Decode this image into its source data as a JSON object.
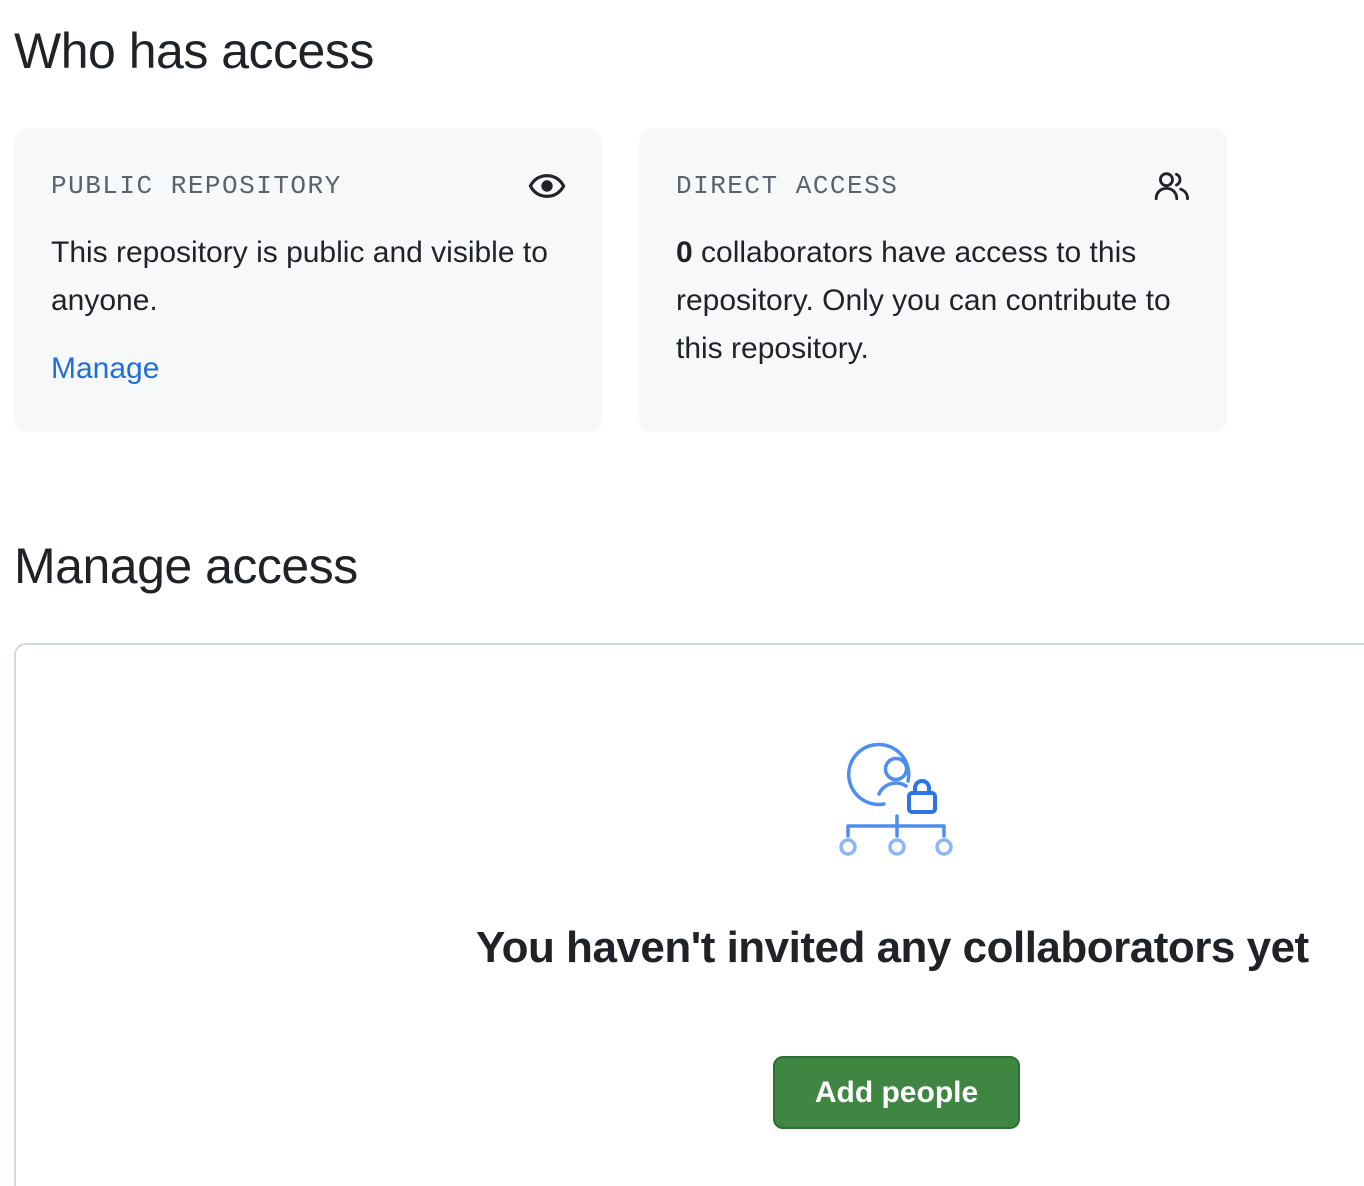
{
  "who_has_access": {
    "title": "Who has access",
    "public_card": {
      "heading": "PUBLIC REPOSITORY",
      "icon": "eye-icon",
      "description": "This repository is public and visible to anyone.",
      "link_label": "Manage"
    },
    "direct_card": {
      "heading": "DIRECT ACCESS",
      "icon": "people-icon",
      "count": "0",
      "description_rest": " collaborators have access to this repository. Only you can contribute to this repository."
    }
  },
  "manage_access": {
    "title": "Manage access",
    "blankslate": {
      "icon": "person-lock-hierarchy-icon",
      "heading": "You haven't invited any collaborators yet",
      "button_label": "Add people"
    }
  },
  "colors": {
    "link": "#1f6fd8",
    "card_bg": "#f6f8fa",
    "primary_button": "#3e8642",
    "illustration_blue": "#4d8ef0"
  }
}
